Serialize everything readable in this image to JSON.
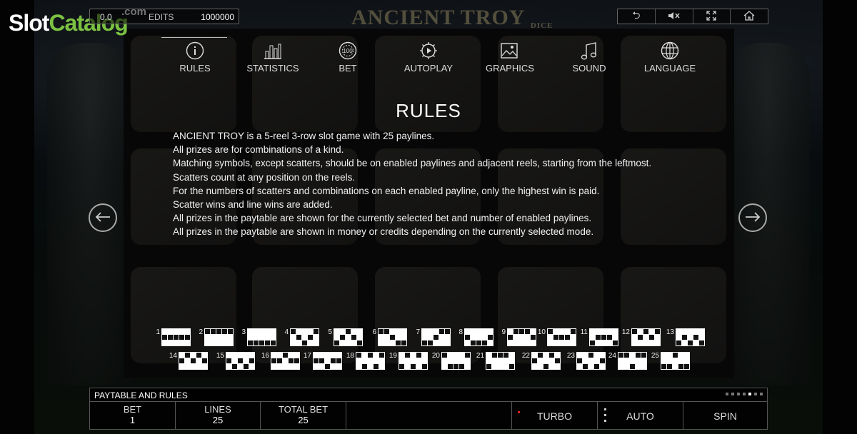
{
  "brand": {
    "word1": "Slot",
    "word2": "Catalog",
    "suffix": ".com"
  },
  "game_title": {
    "main": "ANCIENT TROY",
    "sub": "DICE"
  },
  "top_bar": {
    "coin_value": "0.0",
    "credits_label": "EDITS",
    "credits": "1000000"
  },
  "window_controls": {
    "back": "⮌",
    "mute": "🔇",
    "fullscreen": "⛶",
    "home": "⌂",
    "icons": [
      "back-icon",
      "mute-icon",
      "fullscreen-icon",
      "home-icon"
    ]
  },
  "tabs": [
    {
      "label": "RULES",
      "icon": "info-icon"
    },
    {
      "label": "STATISTICS",
      "icon": "bar-chart-icon"
    },
    {
      "label": "BET",
      "icon": "chip-icon"
    },
    {
      "label": "AUTOPLAY",
      "icon": "autoplay-icon"
    },
    {
      "label": "GRAPHICS",
      "icon": "image-icon"
    },
    {
      "label": "SOUND",
      "icon": "music-note-icon"
    },
    {
      "label": "LANGUAGE",
      "icon": "globe-icon"
    }
  ],
  "rules": {
    "title": "RULES",
    "paragraphs": [
      "ANCIENT TROY is a 5-reel 3-row slot game with 25 paylines.",
      "All prizes are for combinations of a kind.",
      "Matching symbols, except scatters, should be on enabled paylines and adjacent reels, starting from the leftmost.",
      "Scatters count at any position on the reels.",
      "For the numbers of scatters and combinations on each enabled payline, only the highest win is paid.",
      "Scatter wins and line wins are added.",
      "All prizes in the paytable are shown for the currently selected bet and number of enabled paylines.",
      "All prizes in the paytable are shown in money or credits depending on the currently selected mode."
    ]
  },
  "paylines": [
    {
      "n": "1",
      "rows": [
        1,
        1,
        1,
        1,
        1
      ]
    },
    {
      "n": "2",
      "rows": [
        0,
        0,
        0,
        0,
        0
      ]
    },
    {
      "n": "3",
      "rows": [
        2,
        2,
        2,
        2,
        2
      ]
    },
    {
      "n": "4",
      "rows": [
        0,
        1,
        2,
        1,
        0
      ]
    },
    {
      "n": "5",
      "rows": [
        2,
        1,
        0,
        1,
        2
      ]
    },
    {
      "n": "6",
      "rows": [
        0,
        0,
        1,
        2,
        2
      ]
    },
    {
      "n": "7",
      "rows": [
        2,
        2,
        1,
        0,
        0
      ]
    },
    {
      "n": "8",
      "rows": [
        1,
        2,
        2,
        2,
        1
      ]
    },
    {
      "n": "9",
      "rows": [
        1,
        0,
        0,
        0,
        1
      ]
    },
    {
      "n": "10",
      "rows": [
        0,
        1,
        1,
        1,
        0
      ]
    },
    {
      "n": "11",
      "rows": [
        2,
        1,
        1,
        1,
        2
      ]
    },
    {
      "n": "12",
      "rows": [
        0,
        1,
        0,
        1,
        0
      ]
    },
    {
      "n": "13",
      "rows": [
        2,
        1,
        2,
        1,
        2
      ]
    },
    {
      "n": "14",
      "rows": [
        1,
        0,
        1,
        0,
        1
      ]
    },
    {
      "n": "15",
      "rows": [
        1,
        2,
        1,
        2,
        1
      ]
    },
    {
      "n": "16",
      "rows": [
        1,
        1,
        0,
        1,
        1
      ]
    },
    {
      "n": "17",
      "rows": [
        1,
        1,
        2,
        1,
        1
      ]
    },
    {
      "n": "18",
      "rows": [
        0,
        2,
        0,
        2,
        0
      ]
    },
    {
      "n": "19",
      "rows": [
        2,
        0,
        2,
        0,
        2
      ]
    },
    {
      "n": "20",
      "rows": [
        0,
        2,
        2,
        2,
        0
      ]
    },
    {
      "n": "21",
      "rows": [
        2,
        0,
        0,
        0,
        2
      ]
    },
    {
      "n": "22",
      "rows": [
        1,
        0,
        2,
        0,
        1
      ]
    },
    {
      "n": "23",
      "rows": [
        1,
        2,
        0,
        2,
        1
      ]
    },
    {
      "n": "24",
      "rows": [
        0,
        0,
        2,
        0,
        0
      ]
    },
    {
      "n": "25",
      "rows": [
        2,
        2,
        0,
        2,
        2
      ]
    }
  ],
  "nav": {
    "prev_icon": "arrow-left-icon",
    "next_icon": "arrow-right-icon",
    "prev": "←",
    "next": "→"
  },
  "bottom_bar": {
    "title": "PAYTABLE AND RULES",
    "page_dots": 7,
    "active_dot": 4,
    "bet_label": "BET",
    "bet_value": "1",
    "lines_label": "LINES",
    "lines_value": "25",
    "total_bet_label": "TOTAL BET",
    "total_bet_value": "25",
    "turbo_label": "TURBO",
    "auto_label": "AUTO",
    "spin_label": "SPIN",
    "accent_red": "#e22020"
  }
}
